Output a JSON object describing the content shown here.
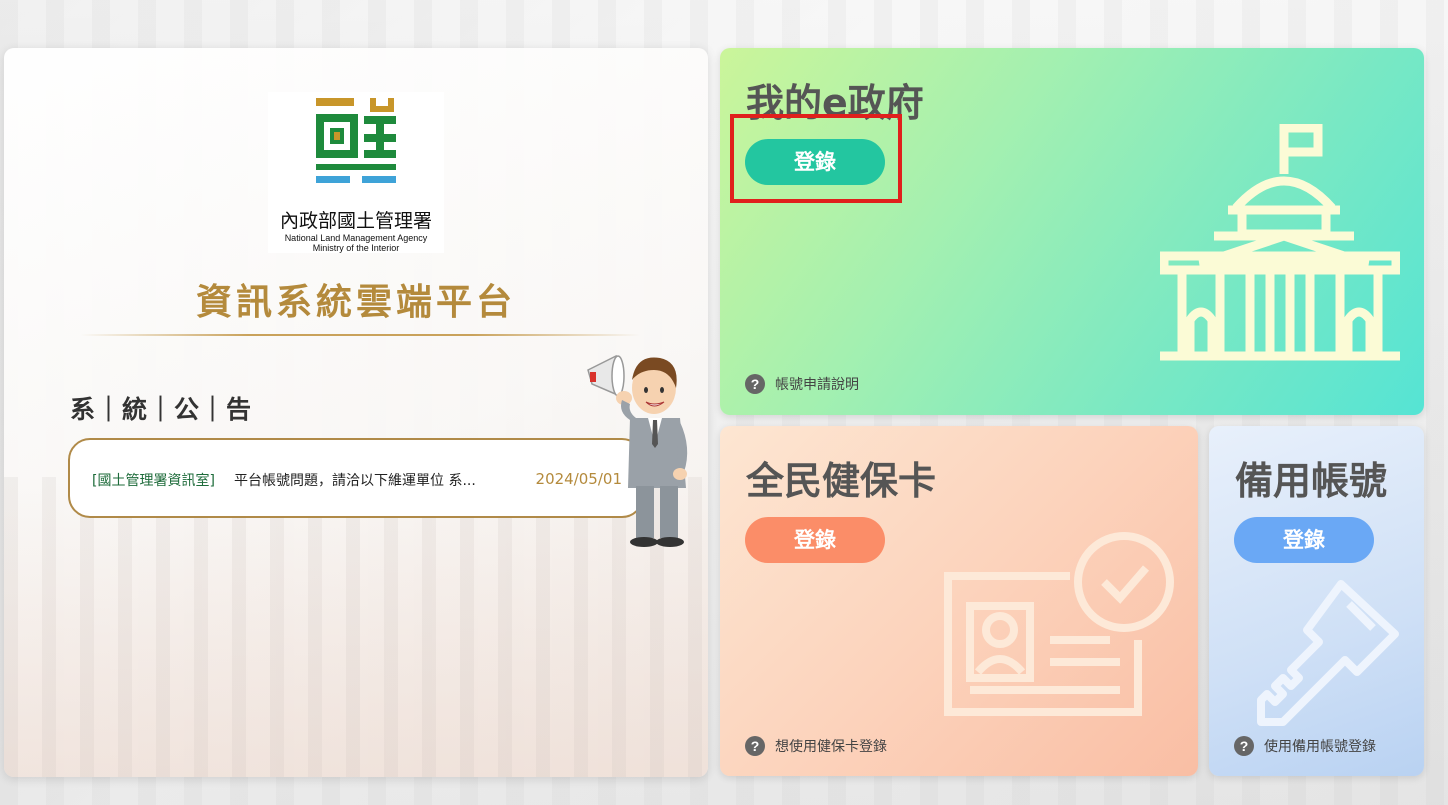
{
  "left_panel": {
    "logo": {
      "zh": "內政部國土管理署",
      "en_line1": "National Land Management Agency",
      "en_line2": "Ministry of the Interior"
    },
    "platform_title": "資訊系統雲端平台",
    "announcements": {
      "heading": "系｜統｜公｜告",
      "items": [
        {
          "source": "[國土管理署資訊室]",
          "text": "平台帳號問題，請洽以下維運單位 系...",
          "date": "2024/05/01"
        }
      ]
    }
  },
  "cards": {
    "egov": {
      "title": "我的e政府",
      "login_label": "登錄",
      "help_label": "帳號申請說明",
      "illustration_icon": "government-building-icon"
    },
    "nhi": {
      "title": "全民健保卡",
      "login_label": "登錄",
      "help_label": "想使用健保卡登錄",
      "illustration_icon": "id-card-check-icon"
    },
    "backup": {
      "title": "備用帳號",
      "login_label": "登錄",
      "help_label": "使用備用帳號登錄",
      "illustration_icon": "key-icon"
    }
  },
  "colors": {
    "brand_gold": "#b48a3c",
    "egov_button": "#23c6a0",
    "nhi_button": "#fb8d68",
    "backup_button": "#6aa8f5",
    "highlight": "#e0201c"
  }
}
